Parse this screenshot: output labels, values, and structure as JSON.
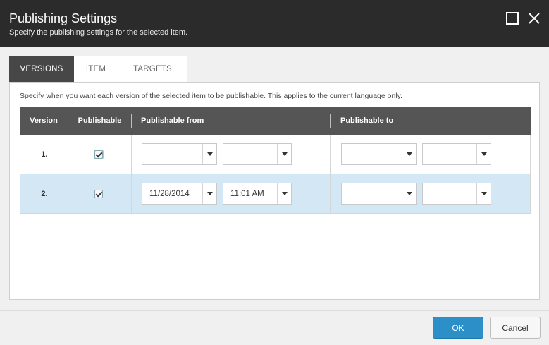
{
  "dialog": {
    "title": "Publishing Settings",
    "subtitle": "Specify the publishing settings for the selected item.",
    "maximize_icon": "maximize-icon",
    "close_icon": "close-icon"
  },
  "tabs": [
    {
      "label": "VERSIONS",
      "active": true
    },
    {
      "label": "ITEM",
      "active": false
    },
    {
      "label": "TARGETS",
      "active": false
    }
  ],
  "versions_panel": {
    "description": "Specify when you want each version of the selected item to be publishable. This applies to the current language only.",
    "columns": [
      "Version",
      "Publishable",
      "Publishable from",
      "Publishable to"
    ],
    "rows": [
      {
        "version": "1.",
        "publishable": true,
        "from_date": "",
        "from_time": "",
        "to_date": "",
        "to_time": "",
        "selected": false
      },
      {
        "version": "2.",
        "publishable": true,
        "from_date": "11/28/2014",
        "from_time": "11:01 AM",
        "to_date": "",
        "to_time": "",
        "selected": true
      }
    ]
  },
  "footer": {
    "ok_label": "OK",
    "cancel_label": "Cancel"
  },
  "colors": {
    "titlebar": "#2b2b2b",
    "active_tab": "#474747",
    "grid_header": "#555555",
    "selected_row": "#d3e8f4",
    "ok_button": "#2c8fc7"
  }
}
